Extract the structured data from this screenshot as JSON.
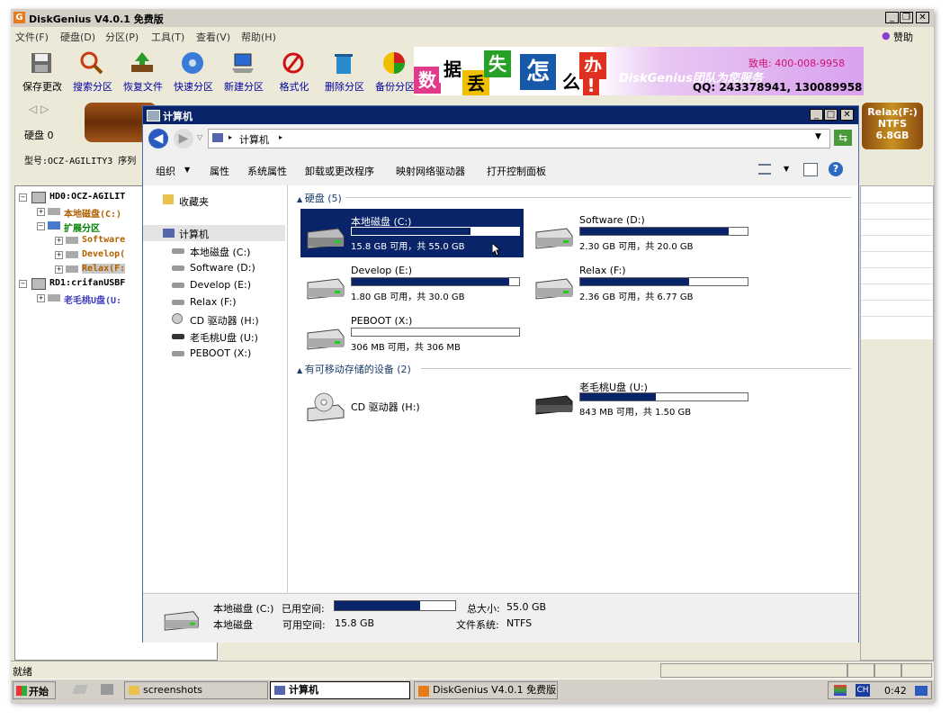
{
  "diskgenius": {
    "title": "DiskGenius V4.0.1 免费版",
    "menu": [
      "文件(F)",
      "硬盘(D)",
      "分区(P)",
      "工具(T)",
      "查看(V)",
      "帮助(H)"
    ],
    "sponsor": "赞助",
    "toolbar": [
      "保存更改",
      "搜索分区",
      "恢复文件",
      "快速分区",
      "新建分区",
      "格式化",
      "删除分区",
      "备份分区"
    ],
    "banner": {
      "chars": [
        "数",
        "据",
        "丢",
        "失",
        "怎",
        "么",
        "办",
        "!"
      ],
      "brand": "DiskGenius团队为您服务",
      "phone": "致电: 400-008-9958",
      "qq": "QQ: 243378941, 13008995​8"
    },
    "disk_label": "硬盘 0",
    "model_label": "型号:OCZ-AGILITY3  序列",
    "partition_badge": {
      "name": "Relax(F:)",
      "fs": "NTFS",
      "size": "6.8GB"
    },
    "tree": [
      {
        "label": "HD0:OCZ-AGILIT",
        "color": "#000000"
      },
      {
        "label": "本地磁盘(C:)",
        "color": "#b06000"
      },
      {
        "label": "扩展分区",
        "color": "#008000"
      },
      {
        "label": "Software",
        "color": "#b06000"
      },
      {
        "label": "Develop(",
        "color": "#b06000"
      },
      {
        "label": "Relax(F:",
        "color": "#b06000"
      },
      {
        "label": "RD1:crifanUSBF",
        "color": "#000000"
      },
      {
        "label": "老毛桃U盘(U:",
        "color": "#4040c0"
      }
    ],
    "status": "就绪"
  },
  "explorer": {
    "title": "计算机",
    "breadcrumb": "计算机",
    "commands": [
      "组织",
      "属性",
      "系统属性",
      "卸载或更改程序",
      "映射网络驱动器",
      "打开控制面板"
    ],
    "nav": {
      "favorites": "收藏夹",
      "computer": "计算机",
      "items": [
        "本地磁盘 (C:)",
        "Software (D:)",
        "Develop (E:)",
        "Relax (F:)",
        "CD 驱动器 (H:)",
        "老毛桃U盘 (U:)",
        "PEBOOT (X:)"
      ]
    },
    "groups": {
      "hdd": "硬盘 (5)",
      "removable": "有可移动存储的设备 (2)"
    },
    "drives": [
      {
        "name": "本地磁盘 (C:)",
        "caption": "15.8 GB 可用，共 55.0 GB",
        "used": 0.71,
        "selected": true
      },
      {
        "name": "Software (D:)",
        "caption": "2.30 GB 可用，共 20.0 GB",
        "used": 0.885
      },
      {
        "name": "Develop (E:)",
        "caption": "1.80 GB 可用，共 30.0 GB",
        "used": 0.94
      },
      {
        "name": "Relax (F:)",
        "caption": "2.36 GB 可用，共 6.77 GB",
        "used": 0.65
      },
      {
        "name": "PEBOOT (X:)",
        "caption": "306 MB 可用，共 306 MB",
        "used": 0.0
      }
    ],
    "removable": [
      {
        "name": "CD 驱动器 (H:)"
      },
      {
        "name": "老毛桃U盘 (U:)",
        "caption": "843 MB 可用，共 1.50 GB",
        "used": 0.45
      }
    ],
    "details": {
      "name": "本地磁盘 (C:)",
      "type": "本地磁盘",
      "used_label": "已用空间:",
      "free_label": "可用空间:",
      "free_value": "15.8 GB",
      "total_label": "总大小:",
      "total_value": "55.0 GB",
      "fs_label": "文件系统:",
      "fs_value": "NTFS",
      "used": 0.71
    }
  },
  "taskbar": {
    "start": "开始",
    "tasks": [
      "screenshots",
      "计算机",
      "DiskGenius V4.0.1 免费版"
    ],
    "lang": "CH",
    "clock": "0:42"
  },
  "colors": {
    "selection": "#0a246a",
    "title_active": "#0a246a"
  }
}
